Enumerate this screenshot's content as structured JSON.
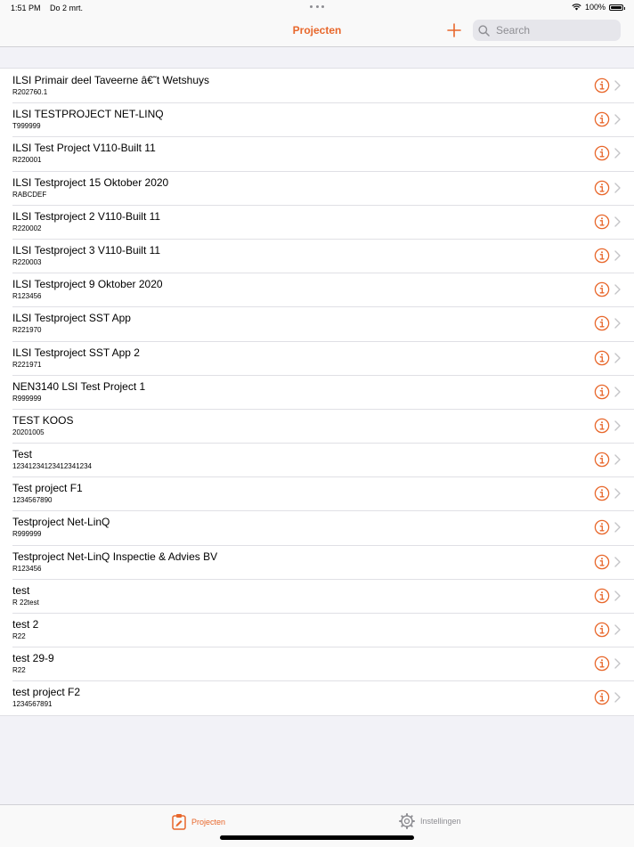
{
  "status_bar": {
    "time": "1:51 PM",
    "date": "Do 2 mrt.",
    "battery": "100%"
  },
  "nav": {
    "title": "Projecten",
    "add_icon": "plus-icon",
    "search_placeholder": "Search"
  },
  "projects": [
    {
      "title": "ILSI Primair deel Taveerne â€˜t Wetshuys",
      "code": "R202760.1"
    },
    {
      "title": "ILSI TESTPROJECT NET-LINQ",
      "code": "T999999"
    },
    {
      "title": "ILSI Test Project V110-Built 11",
      "code": "R220001"
    },
    {
      "title": "ILSI Testproject 15 Oktober 2020",
      "code": "RABCDEF"
    },
    {
      "title": "ILSI Testproject 2 V110-Built 11",
      "code": "R220002"
    },
    {
      "title": "ILSI Testproject 3 V110-Built 11",
      "code": "R220003"
    },
    {
      "title": "ILSI Testproject 9 Oktober 2020",
      "code": "R123456"
    },
    {
      "title": "ILSI Testproject SST App",
      "code": "R221970"
    },
    {
      "title": "ILSI Testproject SST App 2",
      "code": "R221971"
    },
    {
      "title": "NEN3140 LSI Test Project 1",
      "code": "R999999"
    },
    {
      "title": "TEST KOOS",
      "code": "20201005"
    },
    {
      "title": "Test",
      "code": "12341234123412341234"
    },
    {
      "title": "Test project F1",
      "code": "1234567890"
    },
    {
      "title": "Testproject Net-LinQ",
      "code": "R999999"
    },
    {
      "title": "Testproject Net-LinQ Inspectie & Advies BV",
      "code": "R123456"
    },
    {
      "title": "test",
      "code": "R 22test"
    },
    {
      "title": "test 2",
      "code": "R22"
    },
    {
      "title": "test 29-9",
      "code": "R22"
    },
    {
      "title": "test project F2",
      "code": "1234567891"
    }
  ],
  "tabs": [
    {
      "label": "Projecten",
      "icon": "clipboard-icon",
      "active": true
    },
    {
      "label": "Instellingen",
      "icon": "gear-icon",
      "active": false
    }
  ],
  "colors": {
    "accent": "#e8672b",
    "inactive": "#8e8e93"
  }
}
